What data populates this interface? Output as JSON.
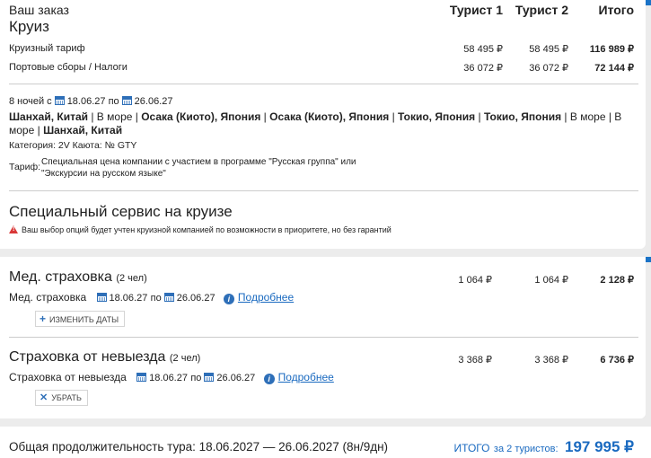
{
  "order": {
    "header_title": "Ваш заказ",
    "col_tourist1": "Турист 1",
    "col_tourist2": "Турист 2",
    "col_total": "Итого",
    "section_title": "Круиз",
    "rows": [
      {
        "label": "Круизный тариф",
        "t1": "58 495 ₽",
        "t2": "58 495 ₽",
        "total": "116 989 ₽"
      },
      {
        "label": "Портовые сборы / Налоги",
        "t1": "36 072 ₽",
        "t2": "36 072 ₽",
        "total": "72 144 ₽"
      }
    ],
    "nights_label": "8 ночей с",
    "date_from": "18.06.27",
    "date_to_word": "по",
    "date_to": "26.06.27",
    "route": [
      {
        "text": "Шанхай, Китай",
        "bold": true
      },
      {
        "text": " | В море | ",
        "bold": false
      },
      {
        "text": "Осака (Киото), Япония",
        "bold": true
      },
      {
        "text": " | ",
        "bold": false
      },
      {
        "text": "Осака (Киото), Япония",
        "bold": true
      },
      {
        "text": " | ",
        "bold": false
      },
      {
        "text": "Токио, Япония",
        "bold": true
      },
      {
        "text": " | ",
        "bold": false
      },
      {
        "text": "Токио, Япония",
        "bold": true
      },
      {
        "text": " | В море | В море | ",
        "bold": false
      },
      {
        "text": "Шанхай, Китай",
        "bold": true
      }
    ],
    "category_line": "Категория: 2V  Каюта: № GTY",
    "tariff_label": "Тариф:",
    "tariff_line1": "Специальная цена компании с участием в программе \"Русская группа\" или",
    "tariff_line2": "\"Экскурсии на русском языке\"",
    "special_title": "Специальный сервис на круизе",
    "special_warning": "Ваш выбор опций будет учтен круизной компанией по возможности в приоритете, но без гарантий"
  },
  "insurance": {
    "med": {
      "title": "Мед. страховка",
      "persons": "(2 чел)",
      "t1": "1 064 ₽",
      "t2": "1 064 ₽",
      "total": "2 128 ₽",
      "sub_label": "Мед. страховка",
      "date_from": "18.06.27",
      "to_word": "по",
      "date_to": "26.06.27",
      "more_link": "Подробнее",
      "button": "ИЗМЕНИТЬ ДАТЫ"
    },
    "cancel": {
      "title": "Страховка от невыезда",
      "persons": "(2 чел)",
      "t1": "3 368 ₽",
      "t2": "3 368 ₽",
      "total": "6 736 ₽",
      "sub_label": "Страховка от невыезда",
      "date_from": "18.06.27",
      "to_word": "по",
      "date_to": "26.06.27",
      "more_link": "Подробнее",
      "button": "УБРАТЬ"
    }
  },
  "footer": {
    "duration": "Общая продолжительность тура: 18.06.2027 — 26.06.2027 (8н/9дн)",
    "total_label": "ИТОГО",
    "total_for": "за 2 туристов:",
    "total_value": "197 995 ₽"
  },
  "colors": {
    "accent": "#1a6ac0",
    "warning": "#d93838"
  }
}
